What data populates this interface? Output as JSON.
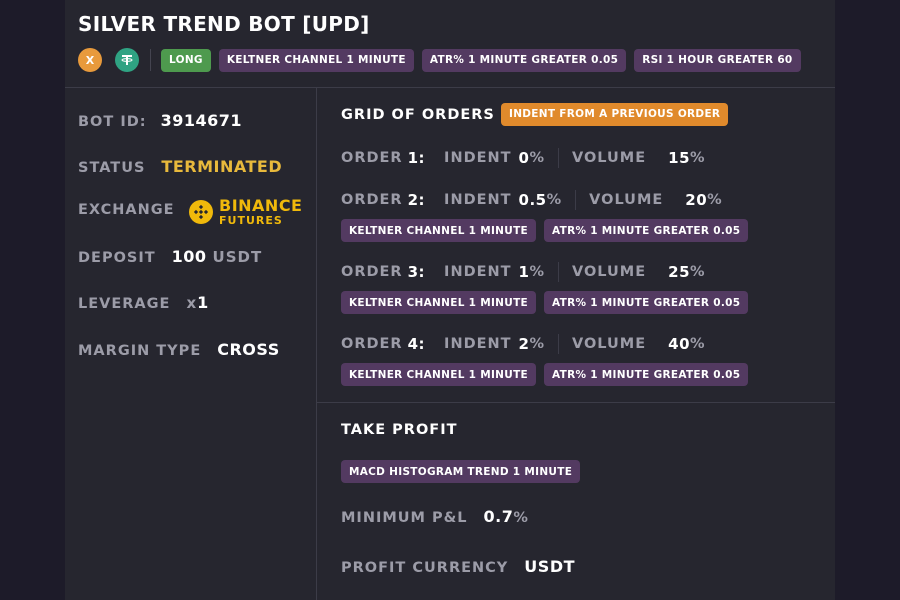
{
  "bot": {
    "title": "SILVER TREND BOT [UPD]",
    "coins": [
      {
        "symbol": "X",
        "icon": "x-coin-icon",
        "color": "#e89a3c"
      },
      {
        "symbol": "T",
        "icon": "tether-icon",
        "color": "#2fa383"
      }
    ],
    "direction": "LONG",
    "header_badges": [
      "KELTNER CHANNEL 1 MINUTE",
      "ATR% 1 MINUTE GREATER 0.05",
      "RSI 1 HOUR GREATER 60"
    ]
  },
  "info": {
    "bot_id_label": "BOT ID:",
    "bot_id": "3914671",
    "status_label": "STATUS",
    "status": "TERMINATED",
    "exchange_label": "EXCHANGE",
    "exchange_name": "BINANCE",
    "exchange_sub": "FUTURES",
    "deposit_label": "DEPOSIT",
    "deposit_value": "100",
    "deposit_currency": "USDT",
    "leverage_label": "LEVERAGE",
    "leverage_prefix": "x",
    "leverage_value": "1",
    "margin_label": "MARGIN TYPE",
    "margin_value": "CROSS"
  },
  "grid": {
    "title": "GRID OF ORDERS",
    "mode_badge": "INDENT FROM A PREVIOUS ORDER",
    "indent_label": "INDENT",
    "volume_label": "VOLUME",
    "orders": [
      {
        "label": "ORDER",
        "num": "1",
        "colon": ":",
        "indent": "0",
        "volume": "15",
        "pct": "%",
        "badges": []
      },
      {
        "label": "ORDER",
        "num": "2",
        "colon": ":",
        "indent": "0.5",
        "volume": "20",
        "pct": "%",
        "badges": [
          "KELTNER CHANNEL 1 MINUTE",
          "ATR% 1 MINUTE GREATER 0.05"
        ]
      },
      {
        "label": "ORDER",
        "num": "3",
        "colon": ":",
        "indent": "1",
        "volume": "25",
        "pct": "%",
        "badges": [
          "KELTNER CHANNEL 1 MINUTE",
          "ATR% 1 MINUTE GREATER 0.05"
        ]
      },
      {
        "label": "ORDER",
        "num": "4",
        "colon": ":",
        "indent": "2",
        "volume": "40",
        "pct": "%",
        "badges": [
          "KELTNER CHANNEL 1 MINUTE",
          "ATR% 1 MINUTE GREATER 0.05"
        ]
      }
    ]
  },
  "take_profit": {
    "title": "TAKE PROFIT",
    "badge": "MACD HISTOGRAM TREND 1 MINUTE",
    "min_pnl_label": "MINIMUM P&L",
    "min_pnl_value": "0.7",
    "min_pnl_pct": "%",
    "currency_label": "PROFIT CURRENCY",
    "currency_value": "USDT"
  },
  "colors": {
    "background": "#1d1b29",
    "card": "#26262f",
    "badge_purple": "#533a61",
    "badge_green": "#4e9a4e",
    "badge_orange": "#e08a2c",
    "status_yellow": "#e8b93c",
    "binance_yellow": "#f0b90b"
  }
}
